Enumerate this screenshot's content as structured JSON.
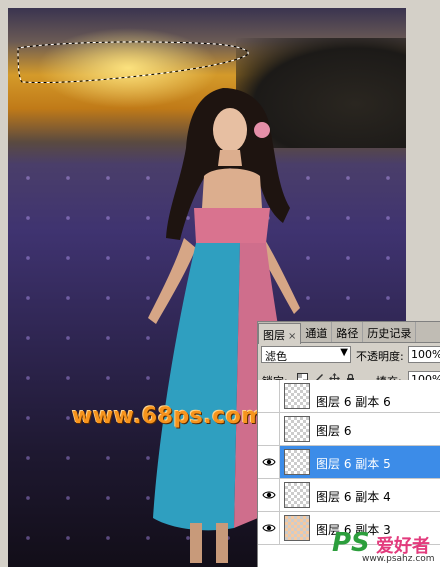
{
  "canvas": {
    "photo_alt": "",
    "watermark": "www.68ps.com",
    "corner_logo": {
      "ps": "PS",
      "cn": "爱好者",
      "url": "www.psahz.com"
    }
  },
  "layers_panel": {
    "tabs": [
      {
        "label": "图层",
        "close": "×",
        "active": true
      },
      {
        "label": "通道",
        "active": false
      },
      {
        "label": "路径",
        "active": false
      },
      {
        "label": "历史记录",
        "active": false
      }
    ],
    "blend_mode": "滤色",
    "opacity_label": "不透明度:",
    "opacity_value": "100%",
    "lock_label": "锁定:",
    "fill_label": "填充:",
    "fill_value": "100%",
    "layers": [
      {
        "name": "图层 6 副本 6",
        "visible": false,
        "selected": false
      },
      {
        "name": "图层 6",
        "visible": false,
        "selected": false
      },
      {
        "name": "图层 6 副本 5",
        "visible": true,
        "selected": true
      },
      {
        "name": "图层 6 副本 4",
        "visible": true,
        "selected": false
      },
      {
        "name": "图层 6 副本 3",
        "visible": true,
        "selected": false
      }
    ]
  },
  "colors": {
    "selection_blue": "#3c8ce8",
    "watermark_orange": "#f7941d"
  }
}
